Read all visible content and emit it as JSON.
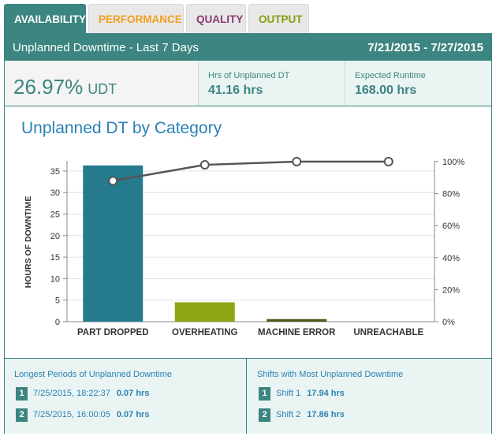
{
  "tabs": [
    {
      "label": "AVAILABILITY",
      "active": true
    },
    {
      "label": "PERFORMANCE",
      "active": false
    },
    {
      "label": "QUALITY",
      "active": false
    },
    {
      "label": "OUTPUT",
      "active": false
    }
  ],
  "header": {
    "title": "Unplanned Downtime - Last 7 Days",
    "date_range": "7/21/2015 - 7/27/2015"
  },
  "stats": {
    "main_value": "26.97%",
    "main_unit": "UDT",
    "hrs_label": "Hrs of Unplanned DT",
    "hrs_value": "41.16 hrs",
    "runtime_label": "Expected Runtime",
    "runtime_value": "168.00 hrs"
  },
  "chart_title": "Unplanned DT by Category",
  "chart_data": {
    "type": "bar",
    "categories": [
      "PART DROPPED",
      "OVERHEATING",
      "MACHINE ERROR",
      "UNREACHABLE"
    ],
    "values": [
      36.3,
      4.5,
      0.6,
      0
    ],
    "line_values_pct": [
      88,
      98,
      100,
      100
    ],
    "ylabel": "HOURS OF DOWNTIME",
    "ylim": [
      0,
      37
    ],
    "y_ticks": [
      0,
      5,
      10,
      15,
      20,
      25,
      30,
      35
    ],
    "y2lim": [
      0,
      100
    ],
    "y2_ticks": [
      "0%",
      "20%",
      "40%",
      "60%",
      "80%",
      "100%"
    ],
    "grid": true,
    "colors": {
      "bars": [
        "#267a8e",
        "#8ea513",
        "#4a5b1e",
        "#3c8580"
      ],
      "line": "#555555"
    }
  },
  "longest": {
    "title": "Longest Periods of Unplanned Downtime",
    "rows": [
      {
        "rank": "1",
        "label": "7/25/2015, 18:22:37",
        "value": "0.07 hrs"
      },
      {
        "rank": "2",
        "label": "7/25/2015, 16:00:05",
        "value": "0.07 hrs"
      }
    ]
  },
  "shifts": {
    "title": "Shifts with Most Unplanned Downtime",
    "rows": [
      {
        "rank": "1",
        "label": "Shift 1",
        "value": "17.94 hrs"
      },
      {
        "rank": "2",
        "label": "Shift 2",
        "value": "17.86 hrs"
      }
    ]
  }
}
